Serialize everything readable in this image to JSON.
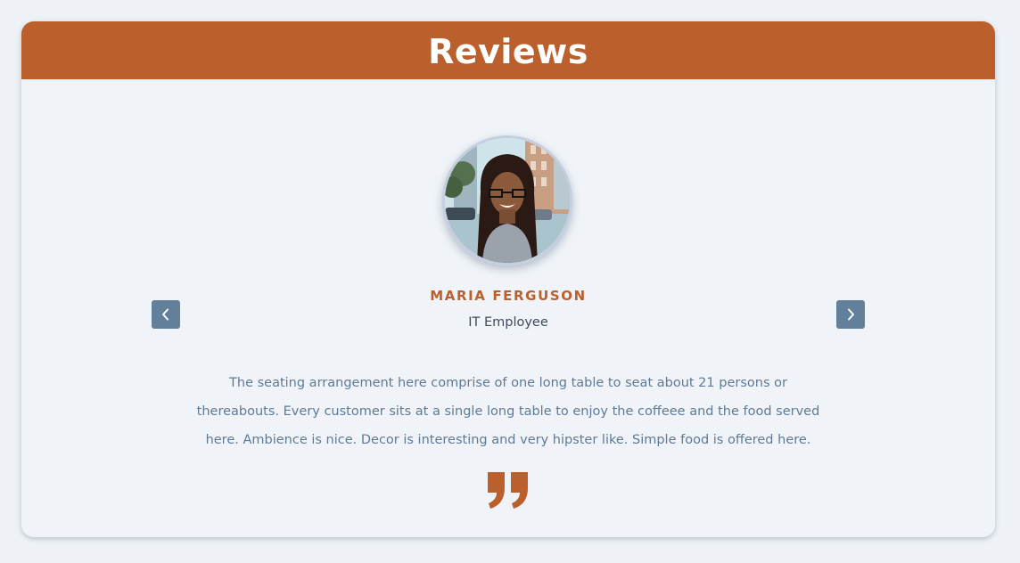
{
  "section": {
    "title": "Reviews"
  },
  "review": {
    "name": "MARIA FERGUSON",
    "role": "IT Employee",
    "text": "The seating arrangement here comprise of one long table to seat about 21 persons or thereabouts. Every customer sits at a single long table to enjoy the coffeee and the food served here. Ambience is nice. Decor is interesting and very hipster like. Simple food is offered here."
  },
  "icons": {
    "prev": "chevron-left-icon",
    "next": "chevron-right-icon",
    "quote": "closing-quote-icon"
  },
  "colors": {
    "accent": "#bb5f2d",
    "nav_button": "#627f9b",
    "body_text": "#5f7a96",
    "background": "#f0f4f8"
  }
}
